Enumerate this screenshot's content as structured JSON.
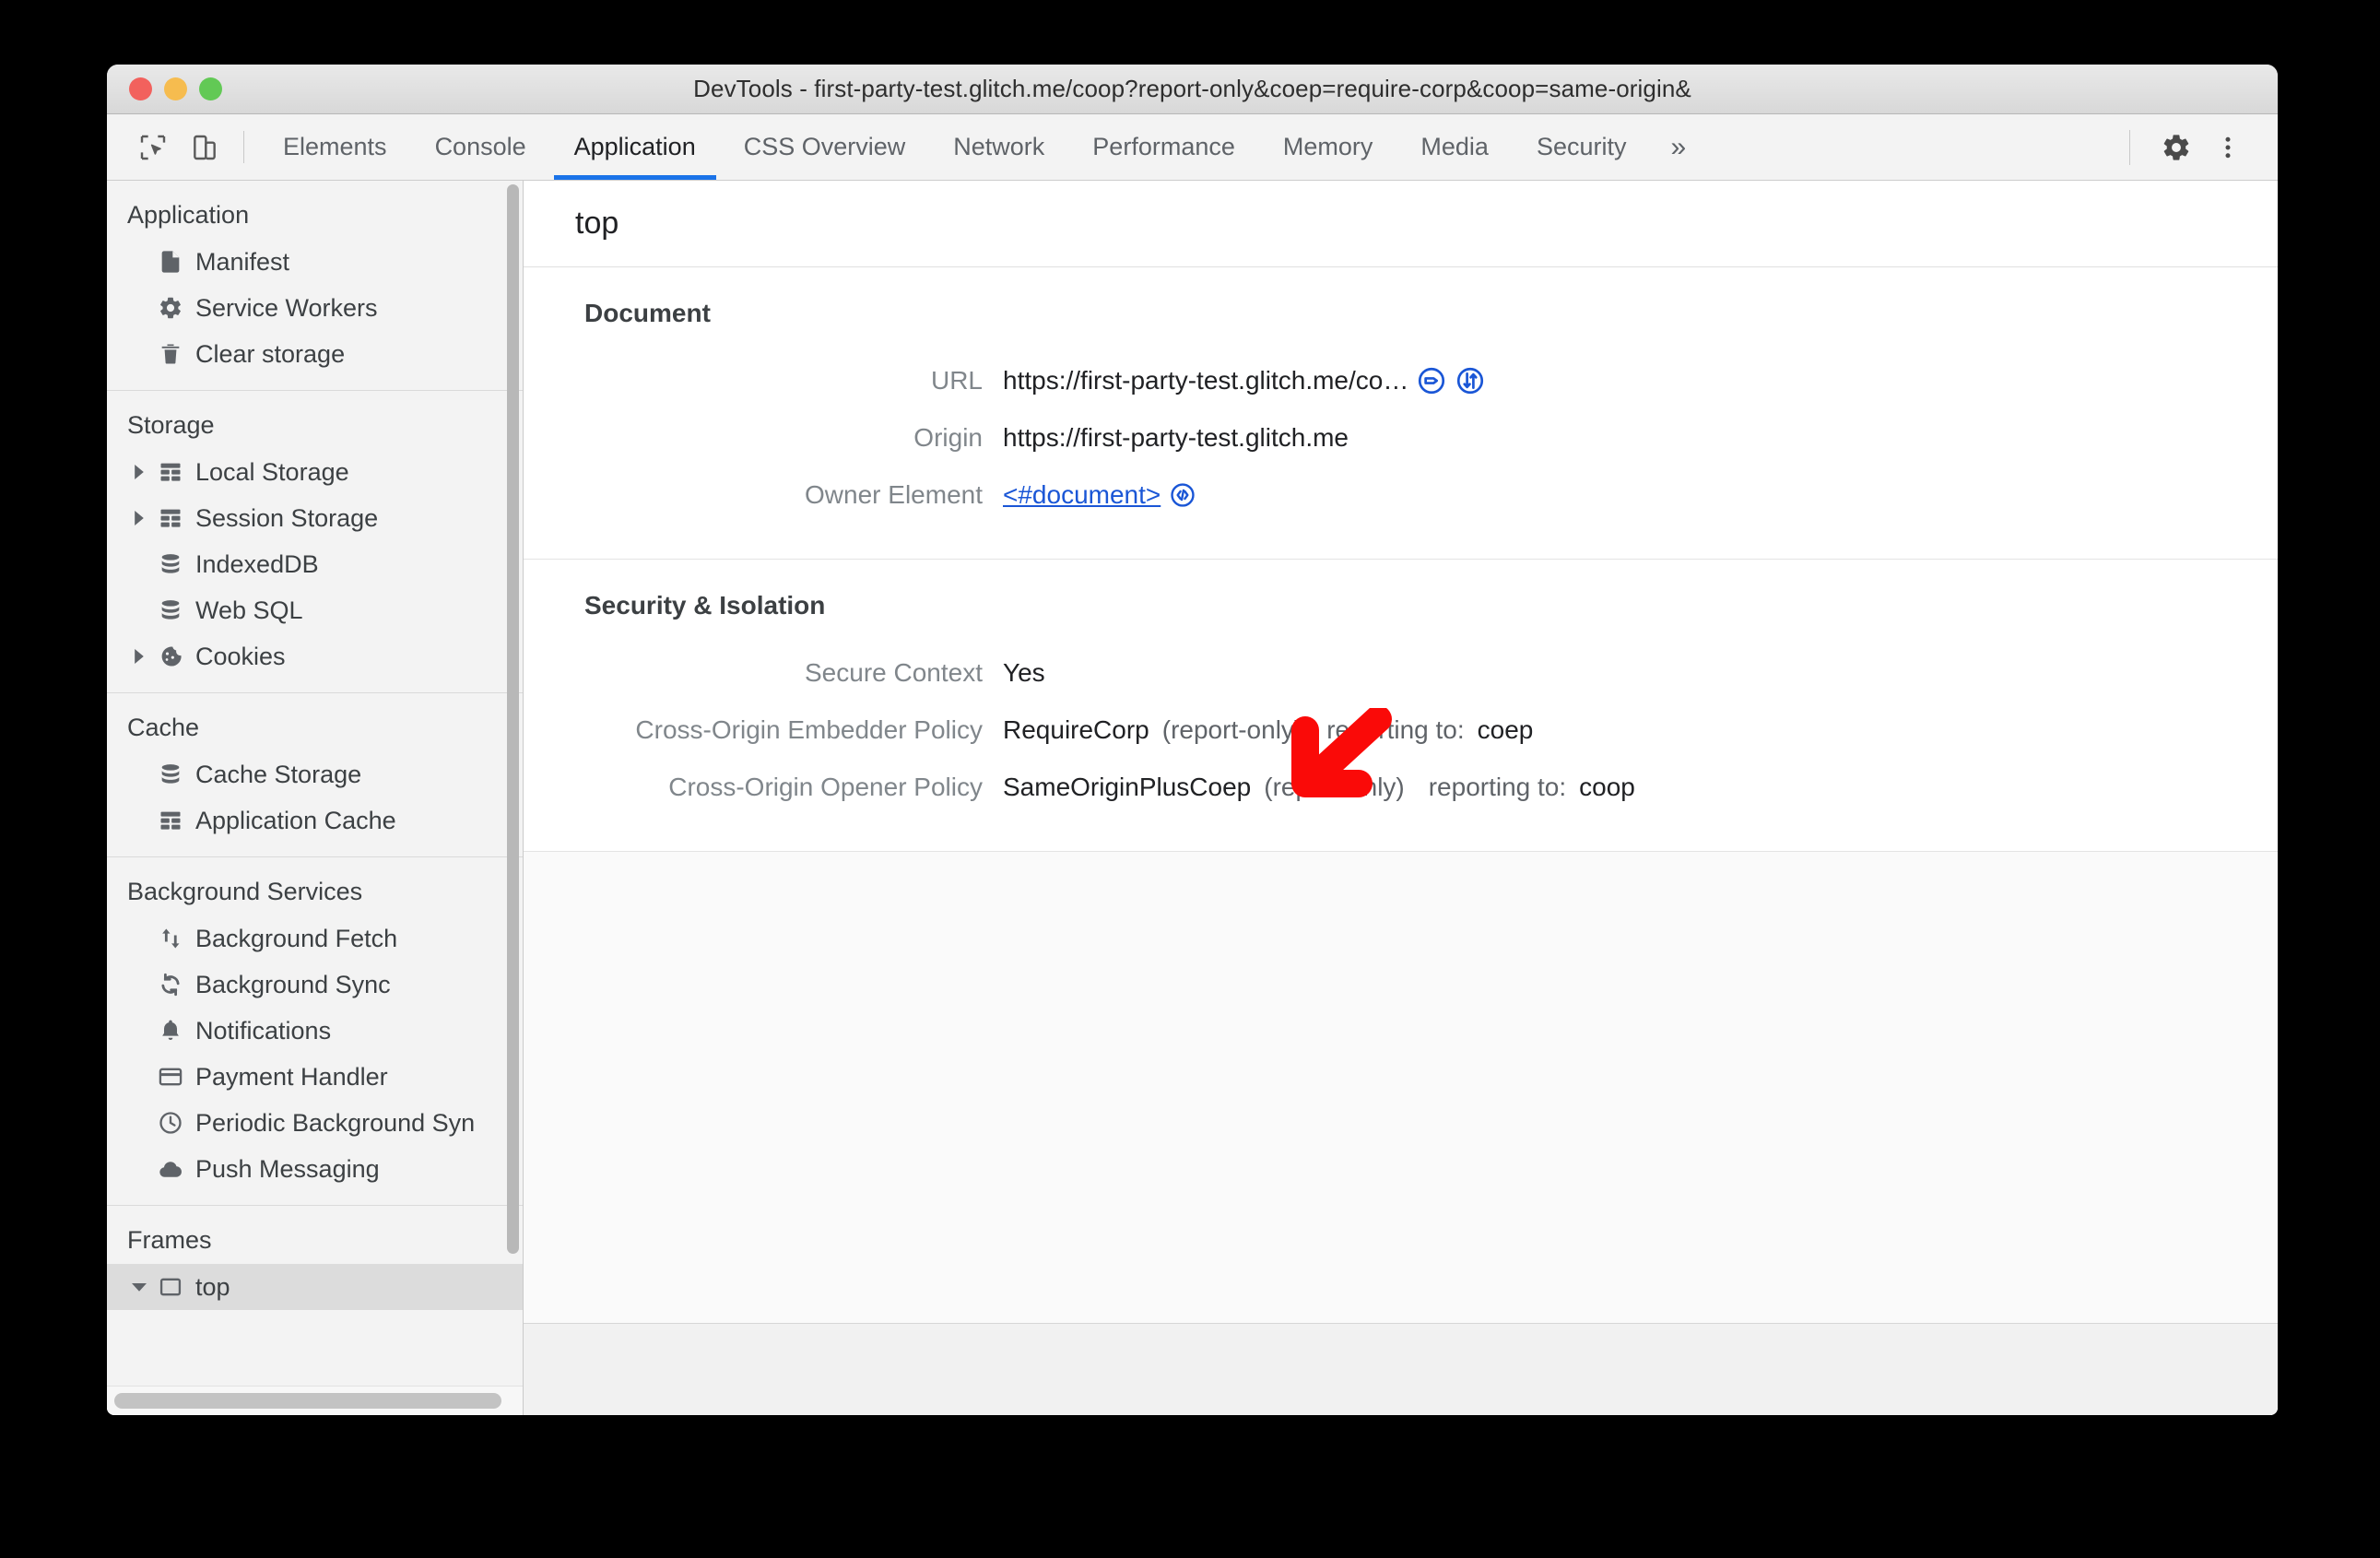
{
  "window": {
    "title": "DevTools - first-party-test.glitch.me/coop?report-only&coep=require-corp&coop=same-origin&",
    "traffic_lights": [
      "close",
      "minimize",
      "zoom"
    ],
    "colors": {
      "close": "#f2615d",
      "minimize": "#f6bc4f",
      "zoom": "#62c955",
      "accent": "#1a73e8",
      "link": "#1a56d6",
      "annotation": "#ff0000"
    }
  },
  "toolbar": {
    "inspect_icon": "inspect-element-icon",
    "device_icon": "device-toolbar-icon",
    "settings_icon": "gear-icon",
    "more_icon": "kebab-menu-icon",
    "tabs": [
      {
        "label": "Elements",
        "active": false
      },
      {
        "label": "Console",
        "active": false
      },
      {
        "label": "Application",
        "active": true
      },
      {
        "label": "CSS Overview",
        "active": false
      },
      {
        "label": "Network",
        "active": false
      },
      {
        "label": "Performance",
        "active": false
      },
      {
        "label": "Memory",
        "active": false
      },
      {
        "label": "Media",
        "active": false
      },
      {
        "label": "Security",
        "active": false
      }
    ],
    "more_tabs_label": "»"
  },
  "sidebar": {
    "groups": [
      {
        "title": "Application",
        "items": [
          {
            "label": "Manifest",
            "icon": "manifest-document-icon",
            "twisty": false,
            "selected": false
          },
          {
            "label": "Service Workers",
            "icon": "gear-icon",
            "twisty": false,
            "selected": false
          },
          {
            "label": "Clear storage",
            "icon": "trash-icon",
            "twisty": false,
            "selected": false
          }
        ]
      },
      {
        "title": "Storage",
        "items": [
          {
            "label": "Local Storage",
            "icon": "table-icon",
            "twisty": true,
            "selected": false
          },
          {
            "label": "Session Storage",
            "icon": "table-icon",
            "twisty": true,
            "selected": false
          },
          {
            "label": "IndexedDB",
            "icon": "database-icon",
            "twisty": false,
            "selected": false
          },
          {
            "label": "Web SQL",
            "icon": "database-icon",
            "twisty": false,
            "selected": false
          },
          {
            "label": "Cookies",
            "icon": "cookie-icon",
            "twisty": true,
            "selected": false
          }
        ]
      },
      {
        "title": "Cache",
        "items": [
          {
            "label": "Cache Storage",
            "icon": "database-icon",
            "twisty": false,
            "selected": false
          },
          {
            "label": "Application Cache",
            "icon": "table-icon",
            "twisty": false,
            "selected": false
          }
        ]
      },
      {
        "title": "Background Services",
        "items": [
          {
            "label": "Background Fetch",
            "icon": "arrows-up-down-icon",
            "twisty": false,
            "selected": false
          },
          {
            "label": "Background Sync",
            "icon": "sync-icon",
            "twisty": false,
            "selected": false
          },
          {
            "label": "Notifications",
            "icon": "bell-icon",
            "twisty": false,
            "selected": false
          },
          {
            "label": "Payment Handler",
            "icon": "credit-card-icon",
            "twisty": false,
            "selected": false
          },
          {
            "label": "Periodic Background Syn",
            "icon": "clock-icon",
            "twisty": false,
            "selected": false
          },
          {
            "label": "Push Messaging",
            "icon": "cloud-icon",
            "twisty": false,
            "selected": false
          }
        ]
      },
      {
        "title": "Frames",
        "items": [
          {
            "label": "top",
            "icon": "frame-icon",
            "twisty": true,
            "expanded": true,
            "selected": true
          }
        ]
      }
    ]
  },
  "main": {
    "frame_name": "top",
    "sections": [
      {
        "title": "Document",
        "rows": [
          {
            "key": "URL",
            "value": "https://first-party-test.glitch.me/co…",
            "icons": [
              "reveal-in-elements-icon",
              "reveal-in-network-icon"
            ]
          },
          {
            "key": "Origin",
            "value": "https://first-party-test.glitch.me"
          },
          {
            "key": "Owner Element",
            "value": "<#document>",
            "is_link": true,
            "icons": [
              "open-in-sources-icon"
            ]
          }
        ]
      },
      {
        "title": "Security & Isolation",
        "rows": [
          {
            "key": "Secure Context",
            "value": "Yes"
          },
          {
            "key": "Cross-Origin Embedder Policy",
            "value": "RequireCorp",
            "suffix": "(report-only)",
            "report_label": "reporting to:",
            "report_value": "coep"
          },
          {
            "key": "Cross-Origin Opener Policy",
            "value": "SameOriginPlusCoep",
            "suffix": "(report-only)",
            "report_label": "reporting to:",
            "report_value": "coop"
          }
        ]
      }
    ]
  },
  "annotation": {
    "arrow": "red-arrow-pointing-down-left",
    "points_at": "Cross-Origin Embedder Policy value"
  }
}
